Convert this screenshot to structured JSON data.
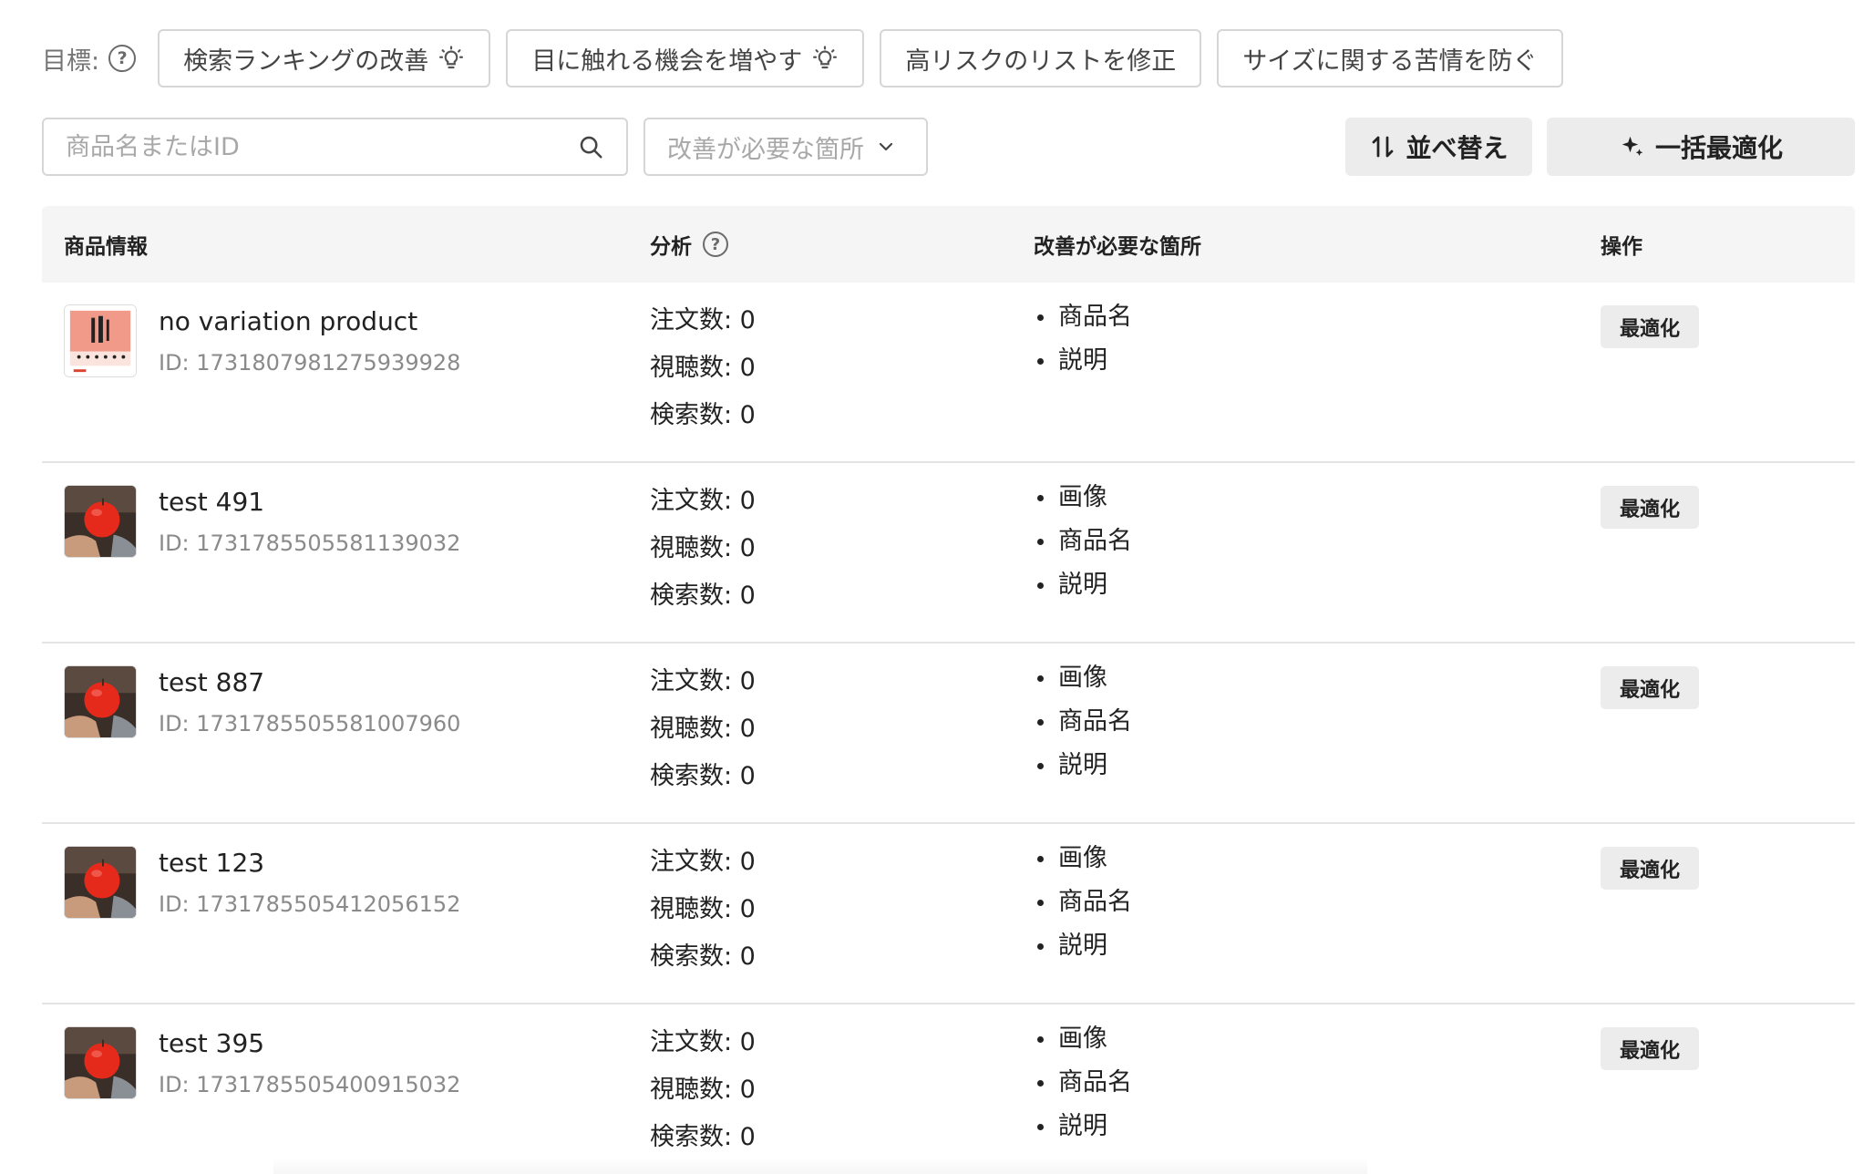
{
  "goals": {
    "label": "目標:",
    "chips": [
      {
        "label": "検索ランキングの改善",
        "icon": "lightbulb-icon"
      },
      {
        "label": "目に触れる機会を増やす",
        "icon": "lightbulb-icon"
      },
      {
        "label": "高リスクのリストを修正",
        "icon": ""
      },
      {
        "label": "サイズに関する苦情を防ぐ",
        "icon": ""
      }
    ]
  },
  "toolbar": {
    "search_placeholder": "商品名またはID",
    "filter_label": "改善が必要な箇所",
    "sort_label": "並べ替え",
    "bulk_label": "一括最適化"
  },
  "table": {
    "headers": {
      "product": "商品情報",
      "analysis": "分析",
      "improve": "改善が必要な箇所",
      "action": "操作"
    },
    "rows": [
      {
        "thumb": "product-thumbnail-tools",
        "name": "no variation product",
        "id": "ID: 1731807981275939928",
        "orders": "注文数: 0",
        "views": "視聴数: 0",
        "searches": "検索数: 0",
        "improve": [
          "商品名",
          "説明"
        ],
        "action": "最適化"
      },
      {
        "thumb": "product-thumbnail-apple",
        "name": "test 491",
        "id": "ID: 1731785505581139032",
        "orders": "注文数: 0",
        "views": "視聴数: 0",
        "searches": "検索数: 0",
        "improve": [
          "画像",
          "商品名",
          "説明"
        ],
        "action": "最適化"
      },
      {
        "thumb": "product-thumbnail-apple",
        "name": "test 887",
        "id": "ID: 1731785505581007960",
        "orders": "注文数: 0",
        "views": "視聴数: 0",
        "searches": "検索数: 0",
        "improve": [
          "画像",
          "商品名",
          "説明"
        ],
        "action": "最適化"
      },
      {
        "thumb": "product-thumbnail-apple",
        "name": "test 123",
        "id": "ID: 1731785505412056152",
        "orders": "注文数: 0",
        "views": "視聴数: 0",
        "searches": "検索数: 0",
        "improve": [
          "画像",
          "商品名",
          "説明"
        ],
        "action": "最適化"
      },
      {
        "thumb": "product-thumbnail-apple",
        "name": "test 395",
        "id": "ID: 1731785505400915032",
        "orders": "注文数: 0",
        "views": "視聴数: 0",
        "searches": "検索数: 0",
        "improve": [
          "画像",
          "商品名",
          "説明"
        ],
        "action": "最適化"
      }
    ]
  }
}
